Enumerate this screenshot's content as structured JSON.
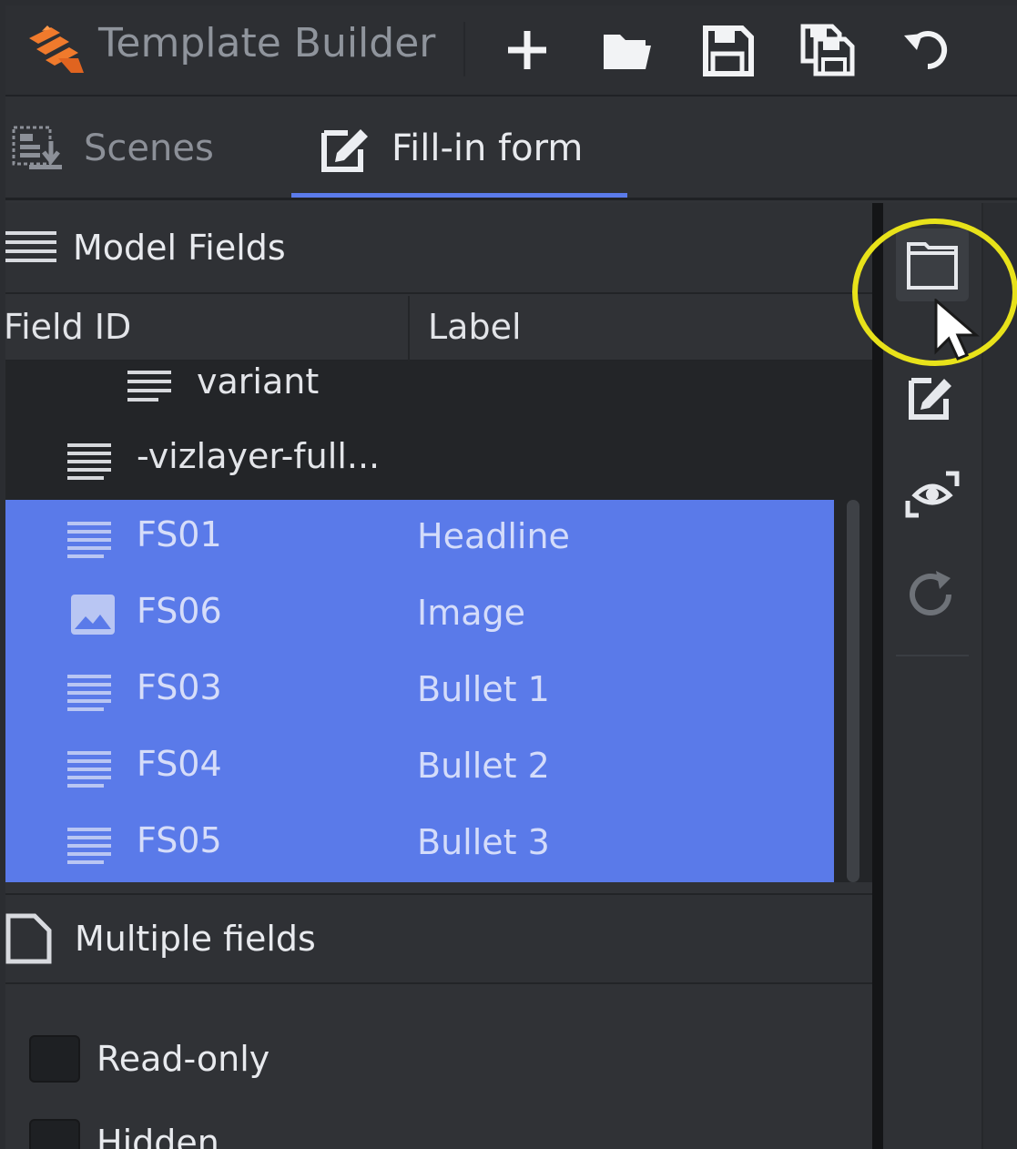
{
  "app": {
    "title": "Template Builder"
  },
  "toolbar": {
    "buttons": [
      "new-icon",
      "open-folder-icon",
      "save-icon",
      "save-as-icon",
      "undo-icon"
    ]
  },
  "tabs": [
    {
      "label": "Scenes",
      "icon": "scenes-icon",
      "active": false
    },
    {
      "label": "Fill-in form",
      "icon": "edit-form-icon",
      "active": true
    }
  ],
  "model_fields": {
    "title": "Model Fields",
    "columns": {
      "field_id": "Field ID",
      "label": "Label"
    },
    "rows": [
      {
        "id": "variant",
        "label": "",
        "icon": "text-lines-icon",
        "selected": false
      },
      {
        "id": "-vizlayer-full...",
        "label": "",
        "icon": "text-lines-icon",
        "selected": false
      },
      {
        "id": "FS01",
        "label": "Headline",
        "icon": "text-lines-icon",
        "selected": true
      },
      {
        "id": "FS06",
        "label": "Image",
        "icon": "image-icon",
        "selected": true
      },
      {
        "id": "FS03",
        "label": "Bullet 1",
        "icon": "text-lines-icon",
        "selected": true
      },
      {
        "id": "FS04",
        "label": "Bullet 2",
        "icon": "text-lines-icon",
        "selected": true
      },
      {
        "id": "FS05",
        "label": "Bullet 3",
        "icon": "text-lines-icon",
        "selected": true
      }
    ]
  },
  "multiple_fields": {
    "title": "Multiple fields",
    "options": [
      {
        "label": "Read-only",
        "checked": false
      },
      {
        "label": "Hidden",
        "checked": false
      }
    ]
  },
  "side_bar": {
    "buttons": [
      "panel-icon",
      "edit-icon",
      "preview-icon",
      "refresh-icon"
    ]
  },
  "colors": {
    "selection": "#5a7ae9",
    "tab_underline": "#5b7bea",
    "highlight_ring": "#e8e21a",
    "logo": "#f07a2c"
  }
}
